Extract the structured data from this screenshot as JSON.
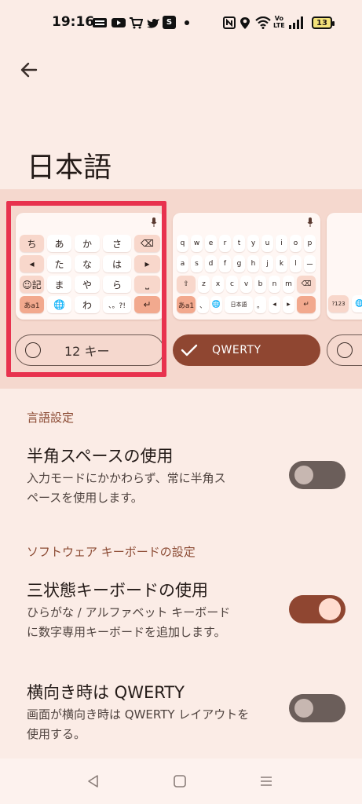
{
  "status_bar": {
    "time": "19:16",
    "battery": "13",
    "app_badges": [
      "S"
    ],
    "volte": [
      "Vo",
      "LTE"
    ]
  },
  "page": {
    "title": "日本語"
  },
  "carousel": {
    "kb12": {
      "rows": [
        [
          "ち",
          "あ",
          "か",
          "さ",
          "⌫"
        ],
        [
          "◂",
          "た",
          "な",
          "は",
          "▸"
        ],
        [
          "☺記",
          "ま",
          "や",
          "ら",
          "⎵"
        ],
        [
          "あa1",
          "🌐",
          "わ",
          "、。?!",
          "↵"
        ]
      ]
    },
    "qwerty": {
      "rows": [
        [
          "q",
          "w",
          "e",
          "r",
          "t",
          "y",
          "u",
          "i",
          "o",
          "p"
        ],
        [
          "a",
          "s",
          "d",
          "f",
          "g",
          "h",
          "j",
          "k",
          "l",
          "ー"
        ],
        [
          "⇧",
          "z",
          "x",
          "c",
          "v",
          "b",
          "n",
          "m",
          "⌫"
        ]
      ],
      "bottom": [
        "あa1",
        "、",
        "🌐",
        "日本語",
        "。",
        "◂",
        "▸",
        "↵"
      ]
    },
    "third": {
      "label": "?123"
    },
    "layout_12_label": "12 キー",
    "layout_qwerty_label": "QWERTY"
  },
  "sections": {
    "language": "言語設定",
    "software_keyboard": "ソフトウェア キーボードの設定"
  },
  "settings": {
    "half_width": {
      "title": "半角スペースの使用",
      "desc1": "入力モードにかかわらず、常に半角ス",
      "desc2": "ペースを使用します。",
      "state": "off"
    },
    "three_state": {
      "title": "三状態キーボードの使用",
      "desc1": "ひらがな / アルファベット キーボード",
      "desc2": "に数字専用キーボードを追加します。",
      "state": "on"
    },
    "landscape": {
      "title": "横向き時は QWERTY",
      "desc1": "画面が横向き時は QWERTY レイアウトを",
      "desc2": "使用する。",
      "state": "off"
    }
  },
  "colors": {
    "background": "#fbece6",
    "accent": "#8f4631",
    "highlight": "#e8324e"
  }
}
